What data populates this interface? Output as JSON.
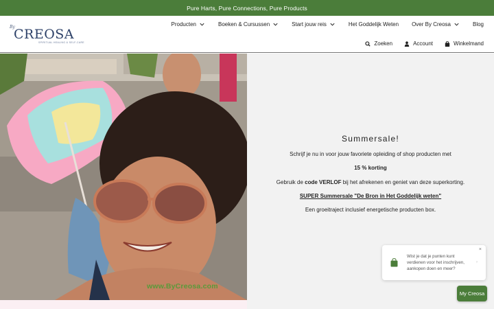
{
  "announcement": "Pure Harts, Pure Connections, Pure Products",
  "logo": {
    "script": "By",
    "name": "CREOSA",
    "tagline": "SPIRITUAL HEALING & SELF-CARE"
  },
  "nav": {
    "items": [
      {
        "label": "Producten",
        "dropdown": true
      },
      {
        "label": "Boeken & Cursussen",
        "dropdown": true
      },
      {
        "label": "Start jouw reis",
        "dropdown": true
      },
      {
        "label": "Het Goddelijk Weten",
        "dropdown": false
      },
      {
        "label": "Over By Creosa",
        "dropdown": true
      },
      {
        "label": "Blog",
        "dropdown": false
      }
    ]
  },
  "utility": {
    "search": "Zoeken",
    "account": "Account",
    "cart": "Winkelmand"
  },
  "hero": {
    "watermark": "www.ByCreosa.com",
    "heading": "Summersale!",
    "p1": "Schrijf je nu in voor jouw favoriete opleiding of shop producten met",
    "p2": "15 % korting",
    "p3_pre": "Gebruik de ",
    "p3_code": "code VERLOF",
    "p3_post": " bij het afrekenen en geniet van deze superkorting.",
    "p4": "SUPER Summersale \"De Bron in Het Goddelijk weten\"",
    "p5": "Een groeitraject inclusief energetische producten box."
  },
  "popup": {
    "close": "×",
    "text": "Wist je dat je punten kunt verdienen voor het inschrijven, aankopen doen en meer?"
  },
  "brand_button": "My Creosa",
  "colors": {
    "brand_green": "#4b7d3a",
    "panel_bg": "#f2f2f2",
    "logo_blue": "#2d4168"
  }
}
